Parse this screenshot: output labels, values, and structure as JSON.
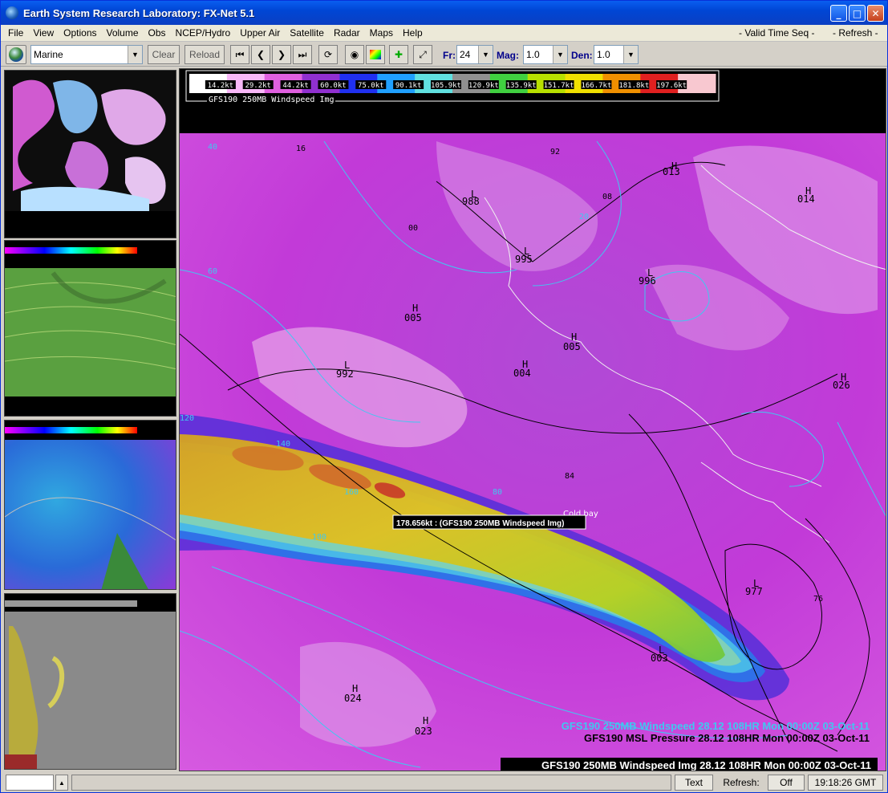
{
  "window": {
    "title": "Earth System Research Laboratory: FX-Net 5.1",
    "minimize_label": "_",
    "maximize_label": "□",
    "close_label": "✕"
  },
  "menu": {
    "items": [
      "File",
      "View",
      "Options",
      "Volume",
      "Obs",
      "NCEP/Hydro",
      "Upper Air",
      "Satellite",
      "Radar",
      "Maps",
      "Help"
    ],
    "valid_time_seq": "- Valid Time Seq -",
    "refresh": "- Refresh -"
  },
  "toolbar": {
    "scale_select": "Marine",
    "clear_label": "Clear",
    "reload_label": "Reload",
    "frames_label": "Fr:",
    "frames_value": "24",
    "mag_label": "Mag:",
    "mag_value": "1.0",
    "den_label": "Den:",
    "den_value": "1.0"
  },
  "colorbar": {
    "ticks": [
      "14.2kt",
      "29.2kt",
      "44.2kt",
      "60.0kt",
      "75.0kt",
      "90.1kt",
      "105.9kt",
      "120.9kt",
      "135.9kt",
      "151.7kt",
      "166.7kt",
      "181.8kt",
      "197.6kt"
    ],
    "colors": [
      "#ffffff",
      "#f8b8f8",
      "#e060e0",
      "#9030d0",
      "#2030f0",
      "#20a0ff",
      "#60e0e0",
      "#909090",
      "#40d040",
      "#b8e000",
      "#f0e000",
      "#f09000",
      "#e02020",
      "#f8c8d0"
    ],
    "caption": "GFS190 250MB Windspeed Img"
  },
  "map": {
    "sample_readout": "178.656kt : (GFS190 250MB Windspeed Img)",
    "place_label": "Cold bay",
    "legend_line1": "GFS190 250MB Windspeed  28.12 108HR Mon 00:00Z 03-Oct-11",
    "legend_line2": "GFS190 MSL Pressure  28.12 108HR Mon 00:00Z 03-Oct-11",
    "legend_line3": "GFS190 250MB Windspeed Img 28.12 108HR Mon 00:00Z 03-Oct-11",
    "pressure_centers": [
      {
        "type": "H",
        "value": "013"
      },
      {
        "type": "H",
        "value": "014"
      },
      {
        "type": "L",
        "value": "988"
      },
      {
        "type": "L",
        "value": "995"
      },
      {
        "type": "L",
        "value": "996"
      },
      {
        "type": "H",
        "value": "005"
      },
      {
        "type": "H",
        "value": "005"
      },
      {
        "type": "L",
        "value": "992"
      },
      {
        "type": "H",
        "value": "004"
      },
      {
        "type": "H",
        "value": "024"
      },
      {
        "type": "H",
        "value": "023"
      },
      {
        "type": "L",
        "value": "003"
      },
      {
        "type": "L",
        "value": "977"
      },
      {
        "type": "H",
        "value": "026"
      }
    ],
    "contour_labels": [
      "16",
      "40",
      "20",
      "60",
      "120",
      "140",
      "160",
      "100",
      "80",
      "00",
      "08",
      "92",
      "84",
      "76"
    ]
  },
  "status": {
    "input_value": "",
    "text_label": "Text",
    "refresh_label": "Refresh:",
    "refresh_value": "Off",
    "time": "19:18:26 GMT"
  }
}
